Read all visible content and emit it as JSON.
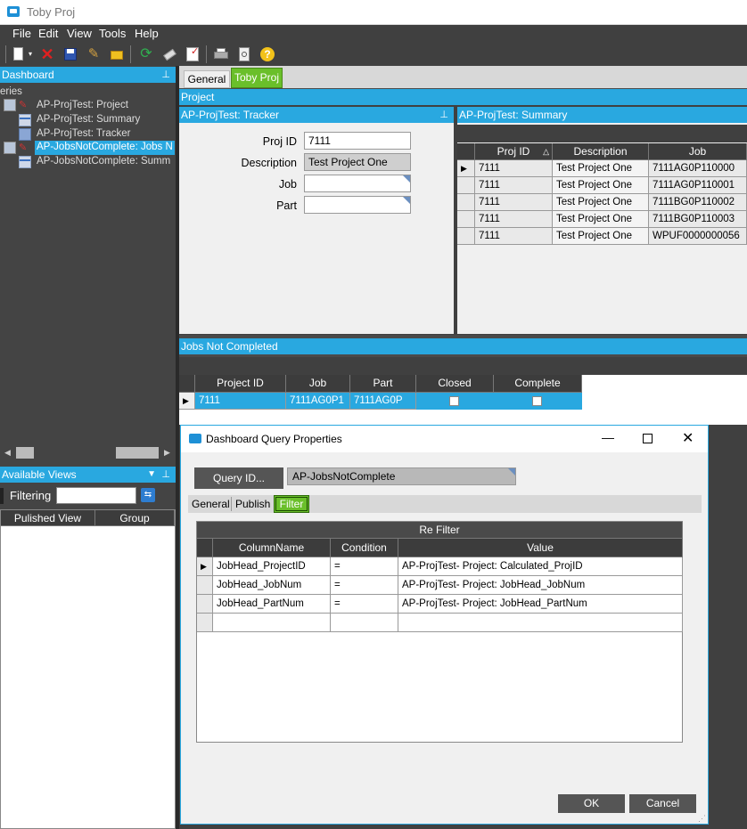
{
  "window": {
    "title": "Toby Proj"
  },
  "menu": [
    "File",
    "Edit",
    "View",
    "Tools",
    "Help"
  ],
  "toolbar_icons": [
    "new-icon",
    "delete-icon",
    "save-icon",
    "clear-icon",
    "folder-icon",
    "refresh-icon",
    "eraser-icon",
    "checklist-icon",
    "print-icon",
    "print-preview-icon",
    "help-icon"
  ],
  "dashboard_panel": {
    "title": "Dashboard",
    "tree_group": "eries",
    "items": [
      "AP-ProjTest: Project",
      "AP-ProjTest: Summary",
      "AP-ProjTest: Tracker",
      "AP-JobsNotComplete: Jobs N",
      "AP-JobsNotComplete: Summ"
    ]
  },
  "views_panel": {
    "title": "Available Views",
    "filter_label": "Filtering",
    "filter_value": "",
    "columns": [
      "Pulished View",
      "Group"
    ]
  },
  "tabs": [
    "General",
    "Toby Proj"
  ],
  "project_bar": "Project",
  "tracker": {
    "title": "AP-ProjTest: Tracker",
    "fields": [
      {
        "label": "Proj ID",
        "value": "7111"
      },
      {
        "label": "Description",
        "value": "Test Project One"
      },
      {
        "label": "Job",
        "value": ""
      },
      {
        "label": "Part",
        "value": ""
      }
    ]
  },
  "summary": {
    "title": "AP-ProjTest: Summary",
    "columns": [
      "Proj ID",
      "Description",
      "Job"
    ],
    "rows": [
      [
        "7111",
        "Test Project One",
        "7111AG0P110000"
      ],
      [
        "7111",
        "Test Project One",
        "7111AG0P110001"
      ],
      [
        "7111",
        "Test Project One",
        "7111BG0P110002"
      ],
      [
        "7111",
        "Test Project One",
        "7111BG0P110003"
      ],
      [
        "7111",
        "Test Project One",
        "WPUF0000000056"
      ]
    ]
  },
  "jobs": {
    "title": "Jobs Not Completed",
    "columns": [
      "Project ID",
      "Job",
      "Part",
      "Closed",
      "Complete"
    ],
    "row": {
      "project_id": "7111",
      "job": "7111AG0P1",
      "part": "7111AG0P",
      "closed": false,
      "complete": false
    }
  },
  "dialog": {
    "title": "Dashboard Query Properties",
    "query_id_button": "Query ID...",
    "query_id_value": "AP-JobsNotComplete",
    "tabs": [
      "General",
      "Publish",
      "Filter"
    ],
    "active_tab": "Filter",
    "filter_title": "Re Filter",
    "filter_columns": [
      "ColumnName",
      "Condition",
      "Value"
    ],
    "filter_rows": [
      [
        "JobHead_ProjectID",
        "=",
        "AP-ProjTest- Project: Calculated_ProjID"
      ],
      [
        "JobHead_JobNum",
        "=",
        "AP-ProjTest- Project: JobHead_JobNum"
      ],
      [
        "JobHead_PartNum",
        "=",
        "AP-ProjTest- Project: JobHead_PartNum"
      ]
    ],
    "ok": "OK",
    "cancel": "Cancel"
  },
  "colors": {
    "accent": "#29a8e0",
    "active_tab": "#6abf2a",
    "dark_bg": "#404040"
  }
}
